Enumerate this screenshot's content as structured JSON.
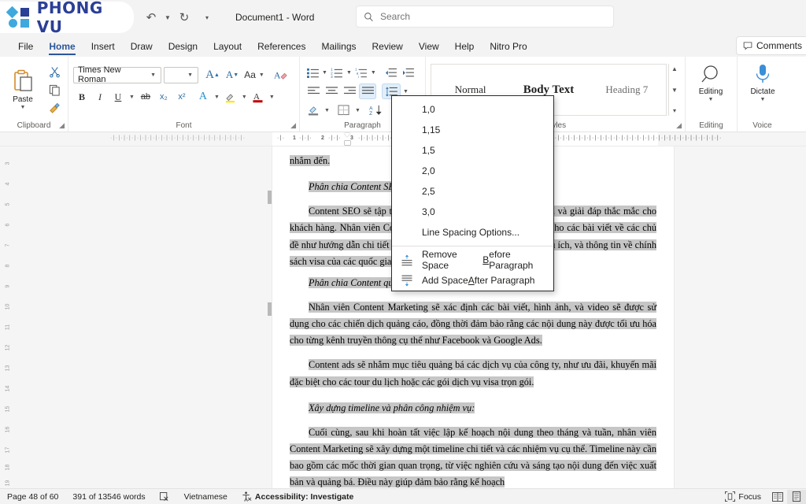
{
  "titlebar": {
    "logo_text": "PHONG VU",
    "document_title": "Document1  -  Word",
    "quick_access": [
      {
        "name": "undo",
        "glyph": "↶"
      },
      {
        "name": "redo",
        "glyph": "↻"
      },
      {
        "name": "customize",
        "glyph": "⌄"
      }
    ]
  },
  "search": {
    "placeholder": "Search"
  },
  "tabs": [
    {
      "label": "File",
      "active": false
    },
    {
      "label": "Home",
      "active": true
    },
    {
      "label": "Insert",
      "active": false
    },
    {
      "label": "Draw",
      "active": false
    },
    {
      "label": "Design",
      "active": false
    },
    {
      "label": "Layout",
      "active": false
    },
    {
      "label": "References",
      "active": false
    },
    {
      "label": "Mailings",
      "active": false
    },
    {
      "label": "Review",
      "active": false
    },
    {
      "label": "View",
      "active": false
    },
    {
      "label": "Help",
      "active": false
    },
    {
      "label": "Nitro Pro",
      "active": false
    }
  ],
  "comments_button": "Comments",
  "ribbon": {
    "clipboard": {
      "label": "Clipboard",
      "paste_label": "Paste",
      "cut_tip": "Cut",
      "copy_tip": "Copy",
      "format_painter_tip": "Format Painter"
    },
    "font": {
      "label": "Font",
      "font_name": "Times New Roman",
      "font_size": "",
      "grow_font": "A",
      "shrink_font": "A",
      "change_case": "Aa",
      "clear_formatting": "A",
      "bold": "B",
      "italic": "I",
      "underline": "U",
      "strikethrough": "ab",
      "subscript": "x₂",
      "superscript": "x²",
      "text_effects": "A",
      "highlight": "✎",
      "font_color": "A"
    },
    "paragraph": {
      "label": "Paragraph",
      "bullets_tip": "Bullets",
      "numbering_tip": "Numbering",
      "multilevel_tip": "Multilevel List",
      "decrease_indent_tip": "Decrease Indent",
      "increase_indent_tip": "Increase Indent",
      "align_left_tip": "Align Left",
      "align_center_tip": "Center",
      "align_right_tip": "Align Right",
      "justify_tip": "Justify",
      "line_spacing_tip": "Line and Paragraph Spacing",
      "shading_tip": "Shading",
      "borders_tip": "Borders",
      "sort_tip": "Sort"
    },
    "styles": {
      "label": "Styles",
      "items": [
        {
          "label": "Normal"
        },
        {
          "label": "Body Text"
        },
        {
          "label": "Heading 7"
        }
      ]
    },
    "editing": {
      "label": "Editing",
      "button": "Editing"
    },
    "voice": {
      "label": "Voice",
      "button": "Dictate"
    }
  },
  "line_spacing_menu": {
    "options": [
      {
        "label": "1,0",
        "icon": null
      },
      {
        "label": "1,15",
        "icon": null
      },
      {
        "label": "1,5",
        "icon": null
      },
      {
        "label": "2,0",
        "icon": null
      },
      {
        "label": "2,5",
        "icon": null
      },
      {
        "label": "3,0",
        "icon": null
      }
    ],
    "line_spacing_options": "Line Spacing Options...",
    "remove_space_before": {
      "pre": "Remove Space ",
      "accel": "B",
      "post": "efore Paragraph",
      "icon": "remove-space-before-icon"
    },
    "add_space_after": {
      "pre": "Add Space ",
      "accel": "A",
      "post": "fter Paragraph",
      "icon": "add-space-after-icon"
    }
  },
  "ruler": {
    "horizontal_numbers": [
      "1",
      "2",
      "3"
    ],
    "vertical_numbers": [
      "3",
      "4",
      "5",
      "6",
      "7",
      "8",
      "9",
      "10",
      "11",
      "12",
      "13",
      "14",
      "15",
      "16",
      "17",
      "18",
      "19"
    ]
  },
  "document": {
    "paragraphs": [
      {
        "type": "body-tail",
        "text": "nhắm đến."
      },
      {
        "type": "heading",
        "text": "Phân chia Content SEO:"
      },
      {
        "type": "body",
        "text": "Content SEO sẽ tập trung vào việc cung cấp thông tin hữu ích và giải đáp thắc mắc cho khách hàng. Nhân viên Content Marketing sẽ lên kế hoạch cụ thể cho các bài viết về các chủ đề như hướng dẫn chi tiết về quy trình xin visa, các mẹo du lịch hữu ích, và thông tin về chính sách visa của các quốc gia, bài viết chia sẽ kết..."
      },
      {
        "type": "heading",
        "text": "Phân chia Content quảng cáo (ads):"
      },
      {
        "type": "body",
        "text": "Nhân viên Content Marketing sẽ xác định các bài viết, hình ảnh, và video sẽ được sử dụng cho các chiến dịch quảng cáo, đồng thời đảm bảo rằng các nội dung này được tối ưu hóa cho từng kênh truyền thông cụ thể như Facebook và Google Ads."
      },
      {
        "type": "body",
        "text": "Content ads sẽ nhắm mục tiêu quảng bá các dịch vụ của công ty, như ưu đãi, khuyến mãi đặc biệt cho các tour du lịch hoặc các gói dịch vụ visa trọn gói."
      },
      {
        "type": "heading",
        "text": "Xây dựng timeline và phân công nhiệm vụ:"
      },
      {
        "type": "body",
        "text": "Cuối cùng, sau khi hoàn tất việc lập kế hoạch nội dung theo tháng và tuần, nhân viên Content Marketing sẽ xây dựng một timeline chi tiết và các nhiệm vụ cụ thể. Timeline này cần bao gồm các mốc thời gian quan trọng, từ việc nghiên cứu và sáng tạo nội dung đến việc xuất bản và quảng bá. Điều này giúp đảm bảo rằng kế hoạch"
      }
    ]
  },
  "statusbar": {
    "page": "Page 48 of 60",
    "words": "391 of 13546 words",
    "proofing_icon": "proofing-errors-icon",
    "language": "Vietnamese",
    "accessibility": "Accessibility: Investigate",
    "focus": "Focus",
    "read_mode_icon": "read-mode-icon",
    "print_layout_icon": "print-layout-icon"
  }
}
